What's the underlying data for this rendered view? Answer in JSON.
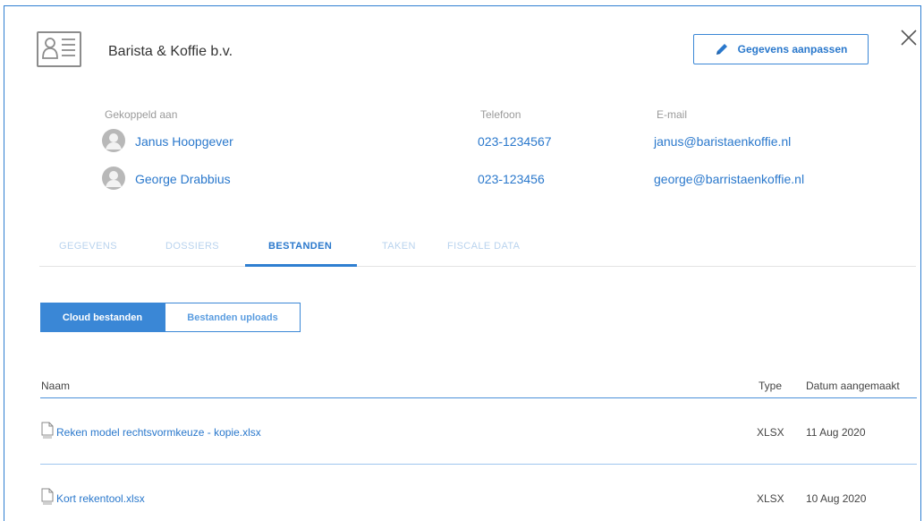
{
  "header": {
    "company_name": "Barista & Koffie b.v.",
    "edit_label": "Gegevens aanpassen"
  },
  "contacts": {
    "headers": {
      "linked": "Gekoppeld aan",
      "phone": "Telefoon",
      "email": "E-mail"
    },
    "rows": [
      {
        "name": "Janus Hoopgever",
        "phone": "023-1234567",
        "email": "janus@baristaenkoffie.nl"
      },
      {
        "name": "George Drabbius",
        "phone": "023-123456",
        "email": "george@barristaenkoffie.nl"
      }
    ]
  },
  "tabs": [
    "GEGEVENS",
    "DOSSIERS",
    "BESTANDEN",
    "TAKEN",
    "FISCALE DATA"
  ],
  "active_tab": "BESTANDEN",
  "segments": {
    "cloud": "Cloud bestanden",
    "upload": "Bestanden uploads"
  },
  "files": {
    "headers": {
      "name": "Naam",
      "type": "Type",
      "date": "Datum aangemaakt"
    },
    "rows": [
      {
        "name": "Reken model rechtsvormkeuze - kopie.xlsx",
        "type": "XLSX",
        "date": "11 Aug 2020"
      },
      {
        "name": "Kort rekentool.xlsx",
        "type": "XLSX",
        "date": "10 Aug 2020"
      }
    ]
  },
  "colors": {
    "accent": "#2f7fd1",
    "link": "#2a78cc",
    "tab_inactive": "#b9d3ee"
  },
  "icons": [
    "contact-card-icon",
    "pencil-icon",
    "close-icon",
    "avatar-icon",
    "file-icon"
  ]
}
